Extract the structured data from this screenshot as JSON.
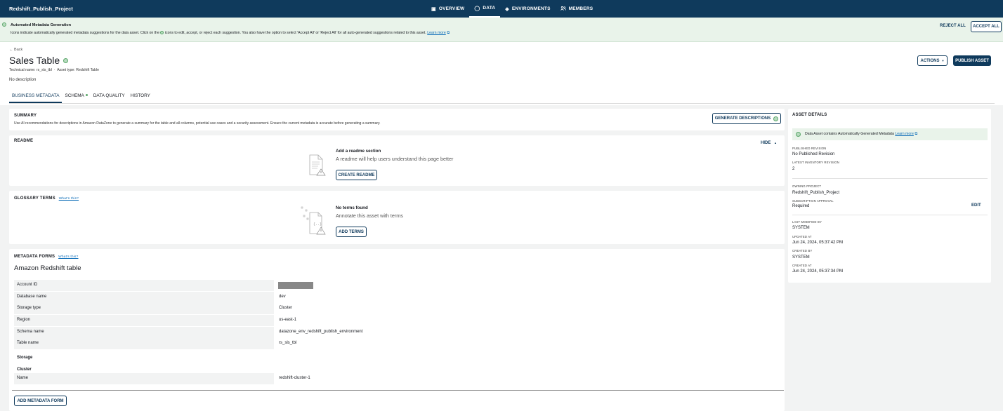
{
  "topnav": {
    "project": "Redshift_Publish_Project",
    "links": [
      {
        "label": "OVERVIEW",
        "icon": "overview-icon",
        "glyph": "▣"
      },
      {
        "label": "DATA",
        "icon": "data-icon",
        "glyph": "◯"
      },
      {
        "label": "ENVIRONMENTS",
        "icon": "environments-icon",
        "glyph": "◈"
      },
      {
        "label": "MEMBERS",
        "icon": "members-icon",
        "glyph": "👥"
      }
    ],
    "active": "DATA"
  },
  "banner": {
    "title": "Automated Metadata Generation",
    "text_before": "Icons indicate automatically generated metadata suggestions for the data asset. Click on the",
    "text_after": "icons to edit, accept, or reject each suggestion. You also have the option to select 'Accept All' or 'Reject All' for all auto-generated suggestions related to this asset.",
    "learn_more": "Learn more",
    "reject_all": "REJECT ALL",
    "accept_all": "ACCEPT ALL"
  },
  "header": {
    "back": "← Back",
    "title": "Sales Table",
    "technical_name_label": "Technical name:",
    "technical_name": "rs_sls_tbl",
    "asset_type_label": "Asset type:",
    "asset_type": "Redshift Table",
    "description": "No description",
    "actions": "ACTIONS",
    "publish": "PUBLISH ASSET"
  },
  "tabs": [
    "BUSINESS METADATA",
    "SCHEMA",
    "DATA QUALITY",
    "HISTORY"
  ],
  "summary": {
    "title": "SUMMARY",
    "text": "Use AI recommendations for descriptions in Amazon DataZone to generate a summary for the table and all columns, potential use cases and a security assessment. Ensure the current metadata is accurate before generating a summary.",
    "button": "GENERATE DESCRIPTIONS"
  },
  "readme": {
    "title": "README",
    "hide": "HIDE",
    "empty_title": "Add a readme section",
    "empty_sub": "A readme will help users understand this page better",
    "button": "CREATE README"
  },
  "glossary": {
    "title": "GLOSSARY TERMS",
    "whats_this": "What's this?",
    "empty_title": "No terms found",
    "empty_sub": "Annotate this asset with terms",
    "button": "ADD TERMS"
  },
  "metadata_forms": {
    "title": "METADATA FORMS",
    "whats_this": "What's this?",
    "form_title": "Amazon Redshift table",
    "rows": [
      {
        "key": "Account ID",
        "value": ""
      },
      {
        "key": "Database name",
        "value": "dev"
      },
      {
        "key": "Storage type",
        "value": "Cluster"
      },
      {
        "key": "Region",
        "value": "us-east-1"
      },
      {
        "key": "Schema name",
        "value": "datazone_env_redshift_publish_environment"
      },
      {
        "key": "Table name",
        "value": "rs_sls_tbl"
      }
    ],
    "storage_heading": "Storage",
    "cluster_heading": "Cluster",
    "cluster_row": {
      "key": "Name",
      "value": "redshift-cluster-1"
    },
    "add_button": "ADD METADATA FORM"
  },
  "asset_details": {
    "title": "ASSET DETAILS",
    "note": "Data Asset contains Automatically Generated Metadata",
    "note_link": "Learn more",
    "published_revision_label": "PUBLISHED REVISION",
    "published_revision": "No Published Revision",
    "latest_inventory_label": "LATEST INVENTORY REVISION",
    "latest_inventory": "2",
    "owning_project_label": "OWNING PROJECT",
    "owning_project": "Redshift_Publish_Project",
    "subscription_label": "SUBSCRIPTION APPROVAL",
    "subscription": "Required",
    "edit": "EDIT",
    "last_modified_label": "LAST MODIFIED BY",
    "last_modified": "SYSTEM",
    "updated_at_label": "UPDATED AT",
    "updated_at": "Jun 24, 2024, 05:37:42 PM",
    "created_by_label": "CREATED BY",
    "created_by": "SYSTEM",
    "created_at_label": "CREATED AT",
    "created_at": "Jun 24, 2024, 05:37:34 PM"
  },
  "colors": {
    "navy": "#0f3a5c",
    "banner_green": "#e9f3ea",
    "link_blue": "#0b6cb8"
  }
}
